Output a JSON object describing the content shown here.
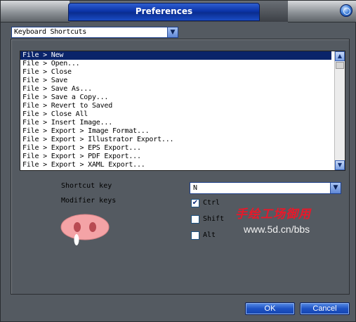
{
  "window": {
    "title": "Preferences"
  },
  "category_dropdown": {
    "value": "Keyboard Shortcuts"
  },
  "shortcut_list": {
    "items": [
      "File > New",
      "File > Open...",
      "File > Close",
      "File > Save",
      "File > Save As...",
      "File > Save a Copy...",
      "File > Revert to Saved",
      "File > Close All",
      "File > Insert Image...",
      "File > Export > Image Format...",
      "File > Export > Illustrator Export...",
      "File > Export > EPS Export...",
      "File > Export > PDF Export...",
      "File > Export > XAML Export..."
    ],
    "selected_index": 0
  },
  "labels": {
    "shortcut_key": "Shortcut key",
    "modifier_keys": "Modifier keys"
  },
  "shortcut_key_dropdown": {
    "value": "N"
  },
  "modifiers": [
    {
      "label": "Ctrl",
      "checked": true
    },
    {
      "label": "Shift",
      "checked": false
    },
    {
      "label": "Alt",
      "checked": false
    }
  ],
  "watermark": {
    "text_cn": "手绘工场御用",
    "url": "www.5d.cn/bbs"
  },
  "buttons": {
    "ok": "OK",
    "cancel": "Cancel"
  },
  "colors": {
    "selection": "#0a246a",
    "watermark_red": "#e8182a",
    "pig_pink": "#f4a3a6"
  }
}
